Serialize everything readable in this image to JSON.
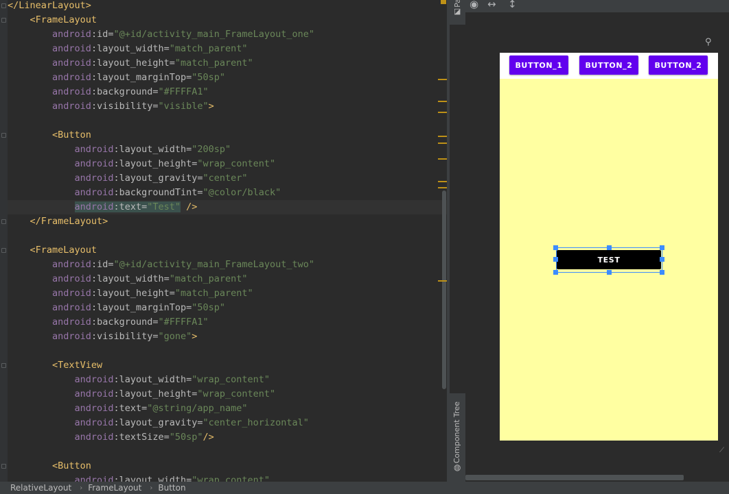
{
  "editor": {
    "lines": [
      {
        "indent": "",
        "parts": [
          {
            "t": "tag",
            "s": "</LinearLayout>"
          }
        ]
      },
      {
        "indent": "    ",
        "parts": [
          {
            "t": "tag",
            "s": "<FrameLayout"
          }
        ]
      },
      {
        "indent": "        ",
        "parts": [
          {
            "t": "ns",
            "s": "android"
          },
          {
            "t": "attr",
            "s": ":id="
          },
          {
            "t": "val",
            "s": "\"@+id/activity_main_FrameLayout_one\""
          }
        ]
      },
      {
        "indent": "        ",
        "parts": [
          {
            "t": "ns",
            "s": "android"
          },
          {
            "t": "attr",
            "s": ":layout_width="
          },
          {
            "t": "val",
            "s": "\"match_parent\""
          }
        ]
      },
      {
        "indent": "        ",
        "parts": [
          {
            "t": "ns",
            "s": "android"
          },
          {
            "t": "attr",
            "s": ":layout_height="
          },
          {
            "t": "val",
            "s": "\"match_parent\""
          }
        ]
      },
      {
        "indent": "        ",
        "parts": [
          {
            "t": "ns",
            "s": "android"
          },
          {
            "t": "attr",
            "s": ":layout_marginTop="
          },
          {
            "t": "val",
            "s": "\"50sp\""
          }
        ]
      },
      {
        "indent": "        ",
        "parts": [
          {
            "t": "ns",
            "s": "android"
          },
          {
            "t": "attr",
            "s": ":background="
          },
          {
            "t": "val",
            "s": "\"#FFFFA1\""
          }
        ]
      },
      {
        "indent": "        ",
        "parts": [
          {
            "t": "ns",
            "s": "android"
          },
          {
            "t": "attr",
            "s": ":visibility="
          },
          {
            "t": "val",
            "s": "\"visible\""
          },
          {
            "t": "tag",
            "s": ">"
          }
        ]
      },
      {
        "indent": "",
        "parts": []
      },
      {
        "indent": "        ",
        "parts": [
          {
            "t": "tag",
            "s": "<Button"
          }
        ]
      },
      {
        "indent": "            ",
        "parts": [
          {
            "t": "ns",
            "s": "android"
          },
          {
            "t": "attr",
            "s": ":layout_width="
          },
          {
            "t": "val",
            "s": "\"200sp\""
          }
        ]
      },
      {
        "indent": "            ",
        "parts": [
          {
            "t": "ns",
            "s": "android"
          },
          {
            "t": "attr",
            "s": ":layout_height="
          },
          {
            "t": "val",
            "s": "\"wrap_content\""
          }
        ]
      },
      {
        "indent": "            ",
        "parts": [
          {
            "t": "ns",
            "s": "android"
          },
          {
            "t": "attr",
            "s": ":layout_gravity="
          },
          {
            "t": "val",
            "s": "\"center\""
          }
        ]
      },
      {
        "indent": "            ",
        "parts": [
          {
            "t": "ns",
            "s": "android"
          },
          {
            "t": "attr",
            "s": ":backgroundTint="
          },
          {
            "t": "val",
            "s": "\"@color/black\""
          }
        ]
      },
      {
        "indent": "            ",
        "current": true,
        "parts": [
          {
            "t": "ns sel",
            "s": "android"
          },
          {
            "t": "attr sel",
            "s": ":text="
          },
          {
            "t": "val sel",
            "s": "\"Test\""
          },
          {
            "t": "tag",
            "s": " />"
          }
        ]
      },
      {
        "indent": "    ",
        "parts": [
          {
            "t": "tag",
            "s": "</FrameLayout>"
          }
        ]
      },
      {
        "indent": "",
        "parts": []
      },
      {
        "indent": "    ",
        "parts": [
          {
            "t": "tag",
            "s": "<FrameLayout"
          }
        ]
      },
      {
        "indent": "        ",
        "parts": [
          {
            "t": "ns",
            "s": "android"
          },
          {
            "t": "attr",
            "s": ":id="
          },
          {
            "t": "val",
            "s": "\"@+id/activity_main_FrameLayout_two\""
          }
        ]
      },
      {
        "indent": "        ",
        "parts": [
          {
            "t": "ns",
            "s": "android"
          },
          {
            "t": "attr",
            "s": ":layout_width="
          },
          {
            "t": "val",
            "s": "\"match_parent\""
          }
        ]
      },
      {
        "indent": "        ",
        "parts": [
          {
            "t": "ns",
            "s": "android"
          },
          {
            "t": "attr",
            "s": ":layout_height="
          },
          {
            "t": "val",
            "s": "\"match_parent\""
          }
        ]
      },
      {
        "indent": "        ",
        "parts": [
          {
            "t": "ns",
            "s": "android"
          },
          {
            "t": "attr",
            "s": ":layout_marginTop="
          },
          {
            "t": "val",
            "s": "\"50sp\""
          }
        ]
      },
      {
        "indent": "        ",
        "parts": [
          {
            "t": "ns",
            "s": "android"
          },
          {
            "t": "attr",
            "s": ":background="
          },
          {
            "t": "val",
            "s": "\"#FFFFA1\""
          }
        ]
      },
      {
        "indent": "        ",
        "parts": [
          {
            "t": "ns",
            "s": "android"
          },
          {
            "t": "attr",
            "s": ":visibility="
          },
          {
            "t": "val",
            "s": "\"gone\""
          },
          {
            "t": "tag",
            "s": ">"
          }
        ]
      },
      {
        "indent": "",
        "parts": []
      },
      {
        "indent": "        ",
        "parts": [
          {
            "t": "tag",
            "s": "<TextView"
          }
        ]
      },
      {
        "indent": "            ",
        "parts": [
          {
            "t": "ns",
            "s": "android"
          },
          {
            "t": "attr",
            "s": ":layout_width="
          },
          {
            "t": "val",
            "s": "\"wrap_content\""
          }
        ]
      },
      {
        "indent": "            ",
        "parts": [
          {
            "t": "ns",
            "s": "android"
          },
          {
            "t": "attr",
            "s": ":layout_height="
          },
          {
            "t": "val",
            "s": "\"wrap_content\""
          }
        ]
      },
      {
        "indent": "            ",
        "parts": [
          {
            "t": "ns",
            "s": "android"
          },
          {
            "t": "attr",
            "s": ":text="
          },
          {
            "t": "val",
            "s": "\"@string/app_name\""
          }
        ]
      },
      {
        "indent": "            ",
        "parts": [
          {
            "t": "ns",
            "s": "android"
          },
          {
            "t": "attr",
            "s": ":layout_gravity="
          },
          {
            "t": "val",
            "s": "\"center_horizontal\""
          }
        ]
      },
      {
        "indent": "            ",
        "parts": [
          {
            "t": "ns",
            "s": "android"
          },
          {
            "t": "attr",
            "s": ":textSize="
          },
          {
            "t": "val",
            "s": "\"50sp\""
          },
          {
            "t": "tag",
            "s": "/>"
          }
        ]
      },
      {
        "indent": "",
        "parts": []
      },
      {
        "indent": "        ",
        "parts": [
          {
            "t": "tag",
            "s": "<Button"
          }
        ]
      },
      {
        "indent": "            ",
        "parts": [
          {
            "t": "ns",
            "s": "android"
          },
          {
            "t": "attr",
            "s": ":layout_width="
          },
          {
            "t": "val",
            "s": "\"wrap_content\""
          }
        ]
      }
    ]
  },
  "sidebar": {
    "palette_label": "Pa",
    "component_tree_label": "Component Tree"
  },
  "design": {
    "toolbar_icons": [
      "eye-icon",
      "horizontal-arrows-icon",
      "vertical-arrows-icon"
    ],
    "buttons": [
      "BUTTON_1",
      "BUTTON_2",
      "BUTTON_2"
    ],
    "test_button": "TEST",
    "colors": {
      "preview_bg": "#FFFFA1",
      "button_purple": "#6200EE",
      "selection": "#3C8CFF"
    }
  },
  "breadcrumb": [
    "RelativeLayout",
    "FrameLayout",
    "Button"
  ]
}
